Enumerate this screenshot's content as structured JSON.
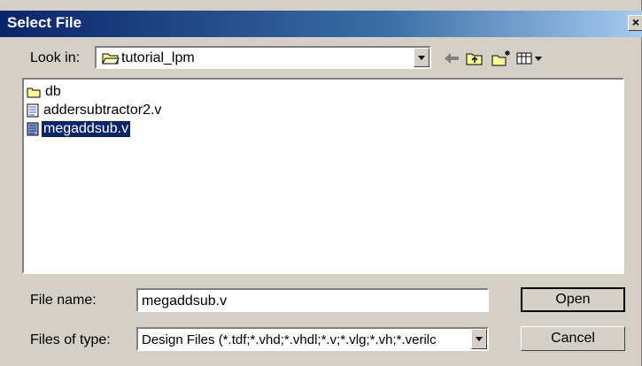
{
  "window": {
    "title": "Select File",
    "close_glyph": "×"
  },
  "lookin": {
    "label": "Look in:",
    "value": "tutorial_lpm"
  },
  "toolbar": {
    "icons": [
      "back-arrow-icon",
      "up-folder-icon",
      "new-folder-icon",
      "view-menu-icon"
    ]
  },
  "files": [
    {
      "name": "db",
      "type": "folder",
      "selected": false
    },
    {
      "name": "addersubtractor2.v",
      "type": "file",
      "selected": false
    },
    {
      "name": "megaddsub.v",
      "type": "file",
      "selected": true
    }
  ],
  "filename": {
    "label": "File name:",
    "value": "megaddsub.v"
  },
  "filetype": {
    "label": "Files of type:",
    "value": "Design Files (*.tdf;*.vhd;*.vhdl;*.v;*.vlg;*.vh;*.verilc"
  },
  "buttons": {
    "open": "Open",
    "cancel": "Cancel"
  },
  "colors": {
    "titlebar_start": "#0a246a",
    "titlebar_end": "#a6caf0",
    "selection": "#0a246a",
    "dialog_bg": "#d4d0c8"
  }
}
